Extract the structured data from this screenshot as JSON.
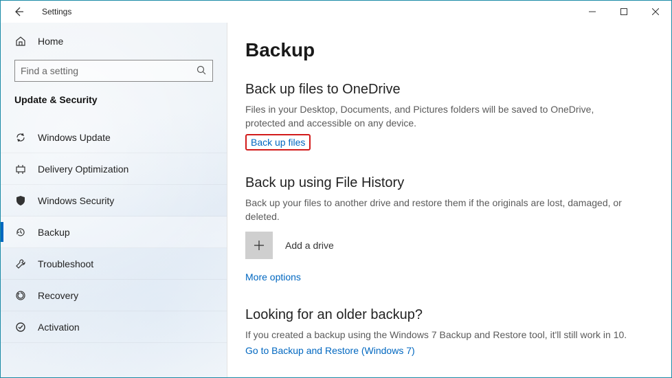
{
  "window": {
    "title": "Settings"
  },
  "sidebar": {
    "home_label": "Home",
    "search_placeholder": "Find a setting",
    "section_title": "Update & Security",
    "items": [
      {
        "label": "Windows Update",
        "icon": "sync"
      },
      {
        "label": "Delivery Optimization",
        "icon": "delivery"
      },
      {
        "label": "Windows Security",
        "icon": "shield"
      },
      {
        "label": "Backup",
        "icon": "history"
      },
      {
        "label": "Troubleshoot",
        "icon": "wrench"
      },
      {
        "label": "Recovery",
        "icon": "recovery"
      },
      {
        "label": "Activation",
        "icon": "check"
      }
    ],
    "active_index": 3
  },
  "main": {
    "page_title": "Backup",
    "sections": {
      "onedrive": {
        "heading": "Back up files to OneDrive",
        "desc": "Files in your Desktop, Documents, and Pictures folders will be saved to OneDrive, protected and accessible on any device.",
        "link_label": "Back up files",
        "link_highlighted": true
      },
      "file_history": {
        "heading": "Back up using File History",
        "desc": "Back up your files to another drive and restore them if the originals are lost, damaged, or deleted.",
        "add_drive_label": "Add a drive",
        "more_options_label": "More options"
      },
      "older_backup": {
        "heading": "Looking for an older backup?",
        "desc": "If you created a backup using the Windows 7 Backup and Restore tool, it'll still work in 10.",
        "link_label": "Go to Backup and Restore (Windows 7)"
      }
    }
  }
}
